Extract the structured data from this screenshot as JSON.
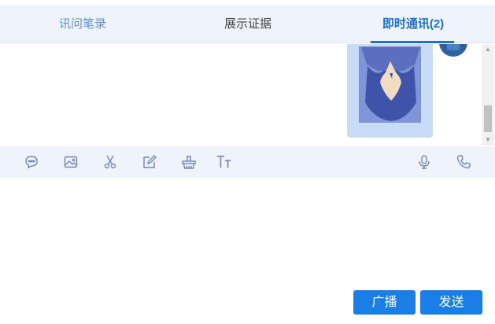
{
  "tabs": [
    {
      "label": "讯问笔录",
      "active": false
    },
    {
      "label": "展示证据",
      "active": false
    },
    {
      "label": "即时通讯(2)",
      "active": true
    }
  ],
  "colors": {
    "accent": "#1a6fd6",
    "tab_bar_bg": "#eef3fc",
    "bubble_bg": "#c6dcf7",
    "button_bg": "#1a7ee6"
  },
  "toolbar": {
    "icons": [
      "emoji-icon",
      "image-icon",
      "scissors-icon",
      "edit-icon",
      "basket-icon",
      "text-size-icon",
      "microphone-icon",
      "phone-icon"
    ]
  },
  "actions": {
    "broadcast_label": "广播",
    "send_label": "发送"
  }
}
